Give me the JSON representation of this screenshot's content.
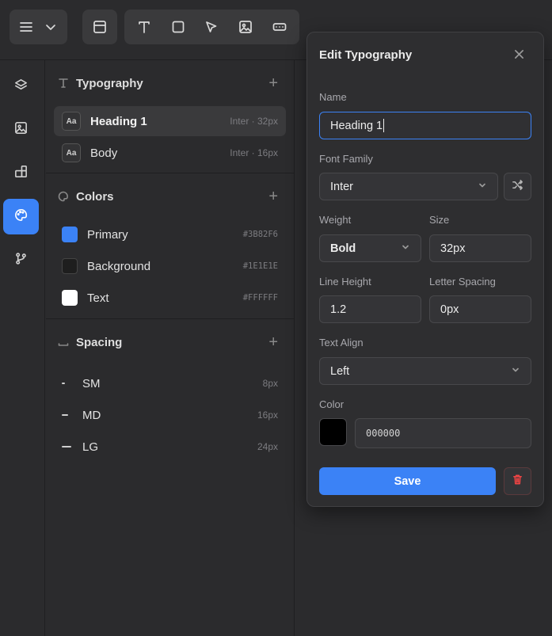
{
  "toolbar": {
    "menu_icon": "hamburger-icon",
    "layout_icon": "layout-icon",
    "tools": [
      "text-tool-icon",
      "rectangle-tool-icon",
      "pointer-tool-icon",
      "image-tool-icon",
      "component-tool-icon"
    ]
  },
  "rail": {
    "items": [
      "layers-icon",
      "image-icon",
      "components-icon",
      "palette-icon",
      "branch-icon"
    ],
    "active": "palette-icon"
  },
  "typography": {
    "title": "Typography",
    "items": [
      {
        "badge": "Aa",
        "name": "Heading 1",
        "meta": "Inter · 32px",
        "selected": true
      },
      {
        "badge": "Aa",
        "name": "Body",
        "meta": "Inter · 16px",
        "selected": false
      }
    ]
  },
  "colors": {
    "title": "Colors",
    "items": [
      {
        "name": "Primary",
        "hex": "#3B82F6",
        "swatch": "#3b82f6"
      },
      {
        "name": "Background",
        "hex": "#1E1E1E",
        "swatch": "#1e1e1e"
      },
      {
        "name": "Text",
        "hex": "#FFFFFF",
        "swatch": "#ffffff"
      }
    ]
  },
  "spacing": {
    "title": "Spacing",
    "items": [
      {
        "name": "SM",
        "value": "8px"
      },
      {
        "name": "MD",
        "value": "16px"
      },
      {
        "name": "LG",
        "value": "24px"
      }
    ]
  },
  "modal": {
    "title": "Edit Typography",
    "name_label": "Name",
    "name_value": "Heading 1",
    "font_family_label": "Font Family",
    "font_family_value": "Inter",
    "weight_label": "Weight",
    "weight_value": "Bold",
    "size_label": "Size",
    "size_value": "32px",
    "line_height_label": "Line Height",
    "line_height_value": "1.2",
    "letter_spacing_label": "Letter Spacing",
    "letter_spacing_value": "0px",
    "text_align_label": "Text Align",
    "text_align_value": "Left",
    "color_label": "Color",
    "color_value": "000000",
    "color_swatch": "#000000",
    "save_label": "Save"
  },
  "accent": "#3b82f6",
  "danger": "#ef4444"
}
